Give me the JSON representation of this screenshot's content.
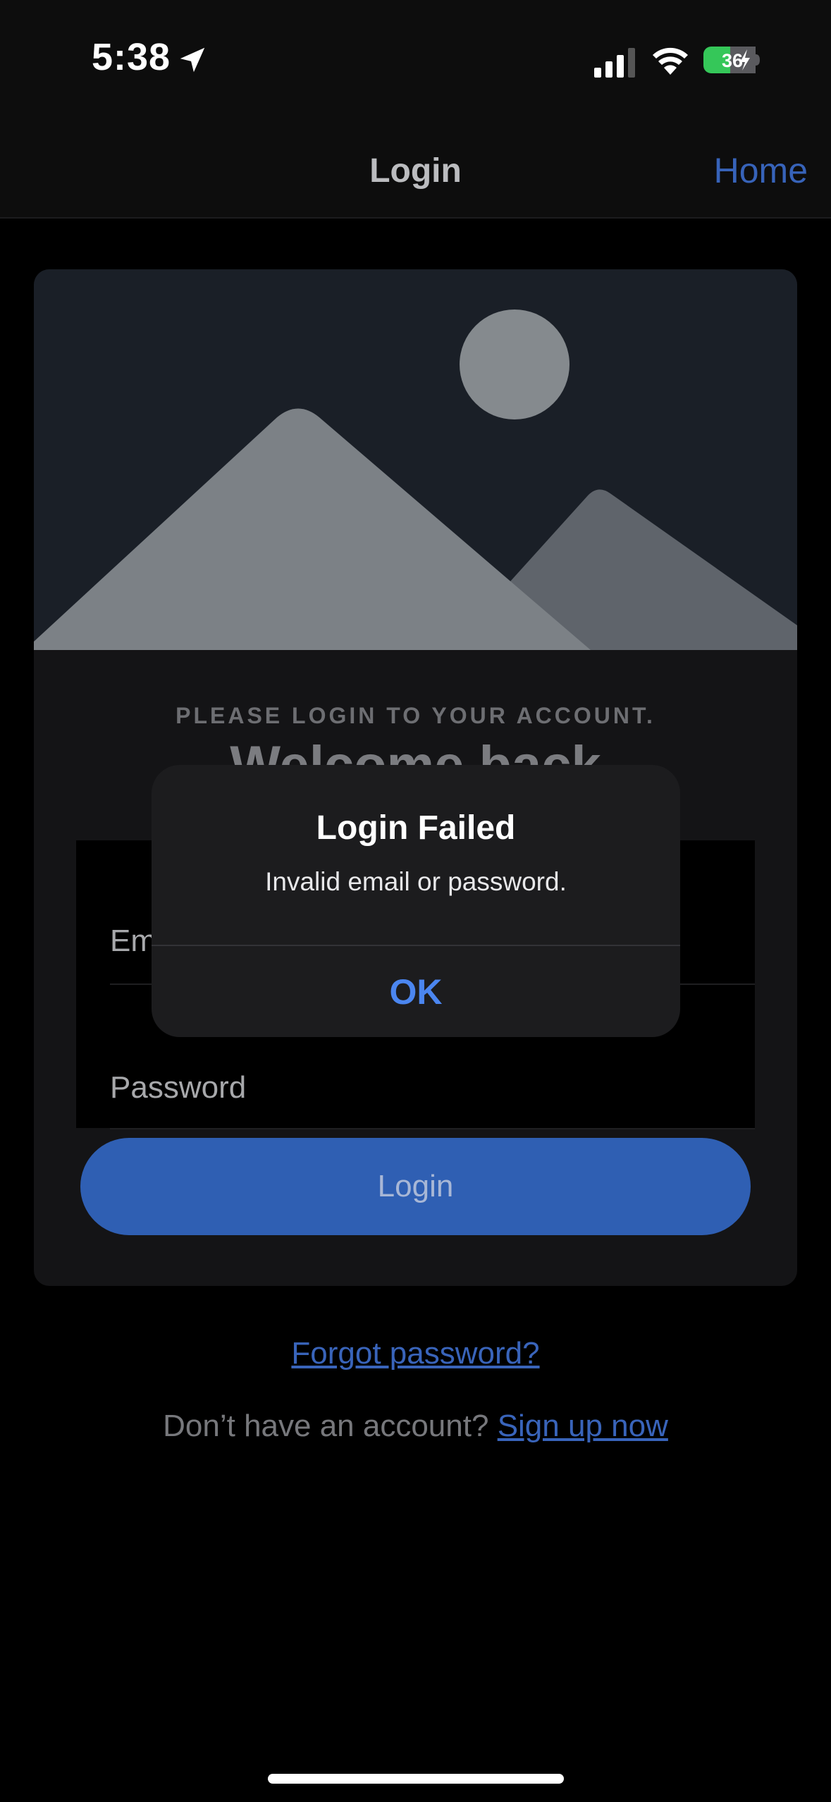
{
  "status_bar": {
    "time": "5:38",
    "battery_level": "36",
    "icons": [
      "location-arrow-icon",
      "signal-icon",
      "wifi-icon",
      "battery-charging-icon"
    ]
  },
  "nav": {
    "title": "Login",
    "home_label": "Home"
  },
  "card": {
    "hero_icon": "image-placeholder-icon",
    "subtitle": "PLEASE LOGIN TO YOUR ACCOUNT.",
    "welcome": "Welcome back",
    "email_placeholder": "Email",
    "password_placeholder": "Password",
    "login_label": "Login"
  },
  "links": {
    "forgot_password": "Forgot password?",
    "signup_prompt": "Don’t have an account?",
    "signup_label": "Sign up now"
  },
  "alert": {
    "title": "Login Failed",
    "message": "Invalid email or password.",
    "ok_label": "OK"
  },
  "colors": {
    "accent": "#2f5fb3",
    "link": "#3964ba",
    "alert_ok": "#4b86f0",
    "battery_green": "#35c759"
  }
}
